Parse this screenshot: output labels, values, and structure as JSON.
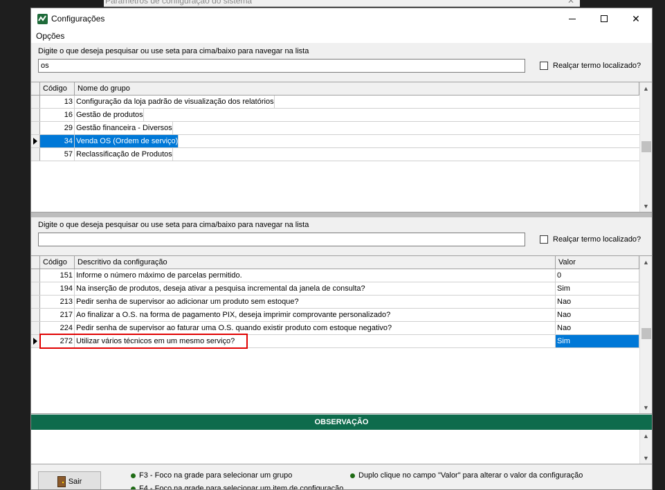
{
  "background_window": {
    "title": "Parâmetros de configuração do sistema"
  },
  "window": {
    "title": "Configurações"
  },
  "menu": {
    "options_label": "Opções"
  },
  "group_search": {
    "label": "Digite o que deseja pesquisar ou use seta para cima/baixo para navegar na lista",
    "value": "os",
    "highlight_label": "Realçar termo localizado?"
  },
  "groups": {
    "headers": {
      "code": "Código",
      "name": "Nome do grupo"
    },
    "rows": [
      {
        "code": "13",
        "name": "Configuração da loja padrão de visualização dos relatórios"
      },
      {
        "code": "16",
        "name": "Gestão de produtos"
      },
      {
        "code": "29",
        "name": "Gestão financeira - Diversos"
      },
      {
        "code": "34",
        "name": "Venda OS (Ordem de serviço)"
      },
      {
        "code": "57",
        "name": "Reclassificação de Produtos"
      }
    ],
    "selected_index": 3
  },
  "config_search": {
    "label": "Digite o que deseja pesquisar ou use seta para cima/baixo para navegar na lista",
    "value": "",
    "highlight_label": "Realçar termo localizado?"
  },
  "configs": {
    "headers": {
      "code": "Código",
      "desc": "Descritivo da configuração",
      "value": "Valor"
    },
    "rows": [
      {
        "code": "151",
        "desc": "Informe o número máximo de parcelas permitido.",
        "value": "0"
      },
      {
        "code": "194",
        "desc": "Na inserção de produtos, deseja ativar a pesquisa incremental da janela de consulta?",
        "value": "Sim"
      },
      {
        "code": "213",
        "desc": "Pedir senha de supervisor ao adicionar um produto sem estoque?",
        "value": "Nao"
      },
      {
        "code": "217",
        "desc": "Ao finalizar a O.S. na forma de pagamento PIX, deseja imprimir comprovante personalizado?",
        "value": "Nao"
      },
      {
        "code": "224",
        "desc": "Pedir senha de supervisor ao faturar uma O.S. quando existir produto com estoque negativo?",
        "value": "Nao"
      },
      {
        "code": "272",
        "desc": "Utilizar vários técnicos em um mesmo serviço?",
        "value": "Sim"
      }
    ],
    "current_index": 5
  },
  "observation": {
    "title": "OBSERVAÇÃO"
  },
  "footer": {
    "exit_label": "Sair",
    "hints": [
      "F3 - Foco na grade para selecionar um grupo",
      "Duplo clique no campo \"Valor\" para alterar o valor da configuração",
      "F4 - Foco na grade para selecionar um item de configuração"
    ]
  },
  "colors": {
    "accent": "#0078d7",
    "observation_bar": "#0e6b4c",
    "highlight_border": "#e00000",
    "hint_dot": "#1e6b14"
  }
}
